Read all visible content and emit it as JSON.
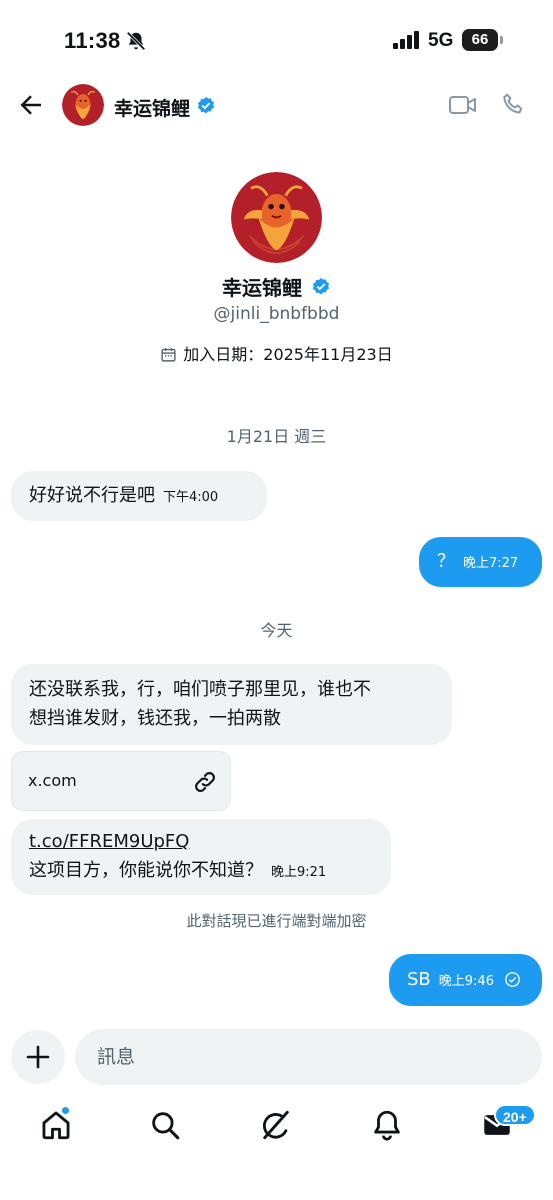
{
  "status_bar": {
    "time": "11:38",
    "network": "5G",
    "battery": "66",
    "icons": [
      "mute-bell-icon",
      "signal-icon"
    ]
  },
  "header": {
    "name": "幸运锦鲤",
    "icons": [
      "back-arrow-icon",
      "verified-badge-icon",
      "video-call-icon",
      "phone-call-icon"
    ]
  },
  "profile": {
    "name": "幸运锦鲤",
    "handle": "@jinli_bnbfbbd",
    "joined": "加入日期：2025年11月23日",
    "accent_color": "#1d9bf0",
    "avatar_bg": "#b3202a"
  },
  "conversation": {
    "date_sep_1": "1月21日 週三",
    "msg1": {
      "text": "好好说不行是吧",
      "time": "下午4:00"
    },
    "msg2": {
      "text": "？",
      "time": "晚上7:27"
    },
    "date_sep_2": "今天",
    "msg3": {
      "line1": "还没联系我，行，咱们喷子那里见，谁也不",
      "line2": "想挡谁发财，钱还我，一拍两散"
    },
    "link_card": {
      "domain": "x.com"
    },
    "msg4": {
      "link": "t.co/FFREM9UpFQ",
      "text": "这项目方，你能说你不知道？",
      "time": "晚上9:21"
    },
    "encryption_note": "此對話現已進行端對端加密",
    "msg5": {
      "text": "SB",
      "time": "晚上9:46"
    }
  },
  "composer": {
    "placeholder": "訊息"
  },
  "bottom_nav": {
    "items": [
      "home-icon",
      "search-icon",
      "grok-icon",
      "notifications-icon",
      "messages-icon"
    ],
    "messages_badge": "20+"
  }
}
